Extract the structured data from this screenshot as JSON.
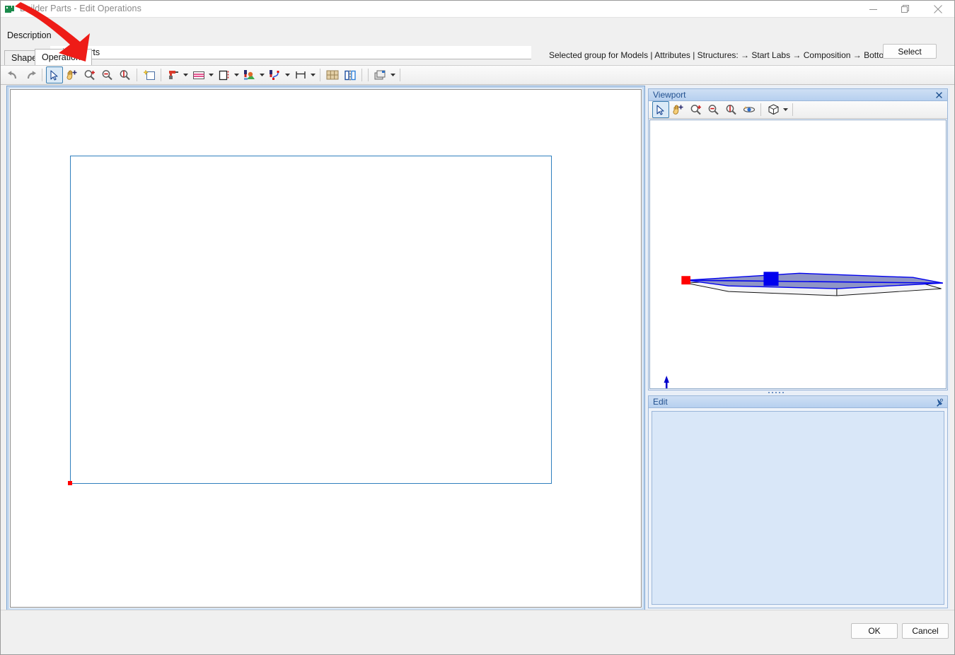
{
  "window": {
    "title": "Builder Parts - Edit Operations",
    "app_icon": "builder-parts-icon",
    "minimize": "minimize-icon",
    "maximize": "restore-icon",
    "close": "close-icon"
  },
  "description": {
    "label": "Description",
    "value": "BuilderParts",
    "placeholder": ""
  },
  "header": {
    "selected_group_text": "Selected group for Models | Attributes | Structures:  → Start Labs → Composition → Bottoms",
    "select_button": "Select"
  },
  "tabs": [
    {
      "label": "Shape",
      "active": false
    },
    {
      "label": "Operations",
      "active": true
    }
  ],
  "toolbar": {
    "items": [
      {
        "name": "undo-icon",
        "kind": "icon",
        "selected": false,
        "caret": false
      },
      {
        "name": "redo-icon",
        "kind": "icon",
        "selected": false,
        "caret": false
      },
      {
        "name": "separator",
        "kind": "sep"
      },
      {
        "name": "select-arrow-icon",
        "kind": "icon",
        "selected": true,
        "caret": false
      },
      {
        "name": "pan-hand-icon",
        "kind": "icon",
        "selected": false,
        "caret": false
      },
      {
        "name": "zoom-in-icon",
        "kind": "icon",
        "selected": false,
        "caret": false
      },
      {
        "name": "zoom-out-icon",
        "kind": "icon",
        "selected": false,
        "caret": false
      },
      {
        "name": "zoom-fit-icon",
        "kind": "icon",
        "selected": false,
        "caret": false
      },
      {
        "name": "separator",
        "kind": "sep"
      },
      {
        "name": "new-sketch-icon",
        "kind": "icon",
        "selected": false,
        "caret": false
      },
      {
        "name": "separator",
        "kind": "sep"
      },
      {
        "name": "drill-tool-icon",
        "kind": "icon",
        "selected": false,
        "caret": true
      },
      {
        "name": "groove-lines-icon",
        "kind": "icon",
        "selected": false,
        "caret": true
      },
      {
        "name": "edge-band-icon",
        "kind": "icon",
        "selected": false,
        "caret": true
      },
      {
        "name": "paint-edge-icon",
        "kind": "icon",
        "selected": false,
        "caret": true
      },
      {
        "name": "spline-cut-icon",
        "kind": "icon",
        "selected": false,
        "caret": true
      },
      {
        "name": "dimension-icon",
        "kind": "icon",
        "selected": false,
        "caret": true
      },
      {
        "name": "separator",
        "kind": "sep"
      },
      {
        "name": "grid-parts-icon",
        "kind": "icon",
        "selected": false,
        "caret": false
      },
      {
        "name": "mirror-icon",
        "kind": "icon",
        "selected": false,
        "caret": false
      },
      {
        "name": "separator",
        "kind": "sep"
      },
      {
        "name": "layers-icon",
        "kind": "icon",
        "selected": false,
        "caret": true
      },
      {
        "name": "separator",
        "kind": "sep"
      }
    ]
  },
  "canvas": {
    "name": "operations-sketch-canvas",
    "shape_outline_color": "#2f7fbe",
    "origin_marker_color": "#ff0000"
  },
  "viewport": {
    "title": "Viewport",
    "close": "close-icon",
    "toolbar": [
      {
        "name": "select-arrow-icon",
        "selected": true,
        "caret": false
      },
      {
        "name": "pan-hand-icon",
        "selected": false,
        "caret": false
      },
      {
        "name": "zoom-in-icon",
        "selected": false,
        "caret": false
      },
      {
        "name": "zoom-out-icon",
        "selected": false,
        "caret": false
      },
      {
        "name": "zoom-fit-icon",
        "selected": false,
        "caret": false
      },
      {
        "name": "orbit-icon",
        "selected": false,
        "caret": false
      },
      {
        "name": "separator",
        "selected": false,
        "caret": false
      },
      {
        "name": "view-cube-icon",
        "selected": false,
        "caret": true
      }
    ],
    "model": {
      "name": "panel-3d-model",
      "body_fill": "#8f95c6",
      "edge_color": "#0000ee",
      "start_marker_color": "#ff0000",
      "node_marker_color": "#0000ee"
    },
    "axis_gizmo": {
      "name": "axis-gizmo",
      "z_color": "#0000cc",
      "y_color": "#66cc88",
      "x_color": "#dd0000"
    }
  },
  "edit_panel": {
    "title": "Edit",
    "pin": "pin-icon",
    "body_text": ""
  },
  "footer": {
    "ok": "OK",
    "cancel": "Cancel"
  },
  "annotation": {
    "arrow_color": "#ee1c17",
    "name": "red-annotation-arrow"
  }
}
